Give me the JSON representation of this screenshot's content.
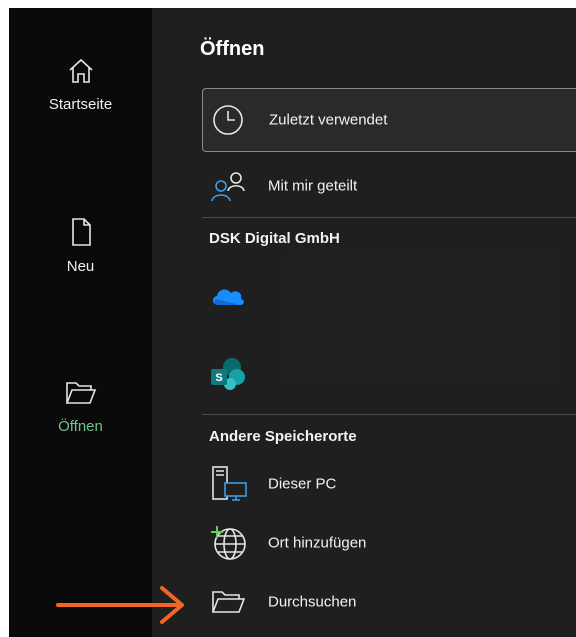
{
  "sidebar": {
    "items": [
      {
        "label": "Startseite",
        "icon": "home-icon",
        "active": false
      },
      {
        "label": "Neu",
        "icon": "new-document-icon",
        "active": false
      },
      {
        "label": "Öffnen",
        "icon": "open-folder-icon",
        "active": true
      }
    ],
    "active_color": "#6fc48a"
  },
  "main": {
    "title": "Öffnen",
    "quick": [
      {
        "label": "Zuletzt verwendet",
        "icon": "clock-icon",
        "selected": true
      },
      {
        "label": "Mit mir geteilt",
        "icon": "shared-people-icon",
        "selected": false
      }
    ],
    "org_section": {
      "title": "DSK Digital GmbH",
      "items": [
        {
          "icon": "onedrive-icon"
        },
        {
          "icon": "sharepoint-icon"
        }
      ]
    },
    "other_section": {
      "title": "Andere Speicherorte",
      "items": [
        {
          "label": "Dieser PC",
          "icon": "computer-icon"
        },
        {
          "label": "Ort hinzufügen",
          "icon": "add-location-globe-icon"
        },
        {
          "label": "Durchsuchen",
          "icon": "browse-folder-icon"
        }
      ]
    }
  },
  "annotation": {
    "icon": "orange-arrow-icon",
    "color": "#f26522"
  }
}
